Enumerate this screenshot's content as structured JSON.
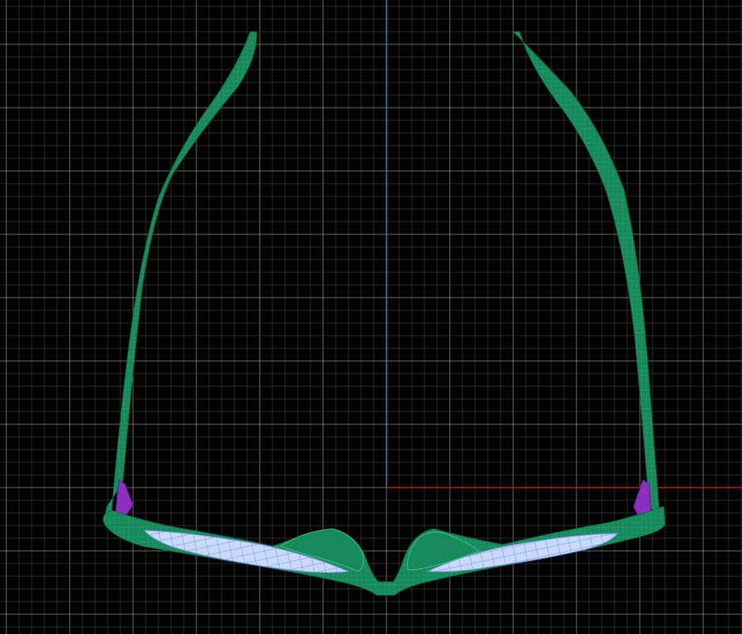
{
  "viewport": {
    "mode": "top view",
    "background_color": "#000000",
    "grid_major_color": "#6e6e6e",
    "grid_minor_color": "#3a3a3a",
    "axis_y_color": "#2e8db8",
    "axis_x_color": "#b01e1e"
  },
  "model": {
    "name": "eyeglasses",
    "parts": [
      {
        "part": "frame",
        "color": "#178a5c",
        "wire_color": "#3fbf85"
      },
      {
        "part": "temple-left",
        "color": "#178a5c"
      },
      {
        "part": "temple-right",
        "color": "#178a5c"
      },
      {
        "part": "lens-left",
        "color": "#c9d9ff",
        "wire_color": "#6f8fdc"
      },
      {
        "part": "lens-right",
        "color": "#c9d9ff",
        "wire_color": "#6f8fdc"
      },
      {
        "part": "hinge-left",
        "color": "#8a2fc0"
      },
      {
        "part": "hinge-right",
        "color": "#8a2fc0"
      },
      {
        "part": "nose-pad-left",
        "color": "#178a5c"
      },
      {
        "part": "nose-pad-right",
        "color": "#178a5c"
      }
    ]
  }
}
